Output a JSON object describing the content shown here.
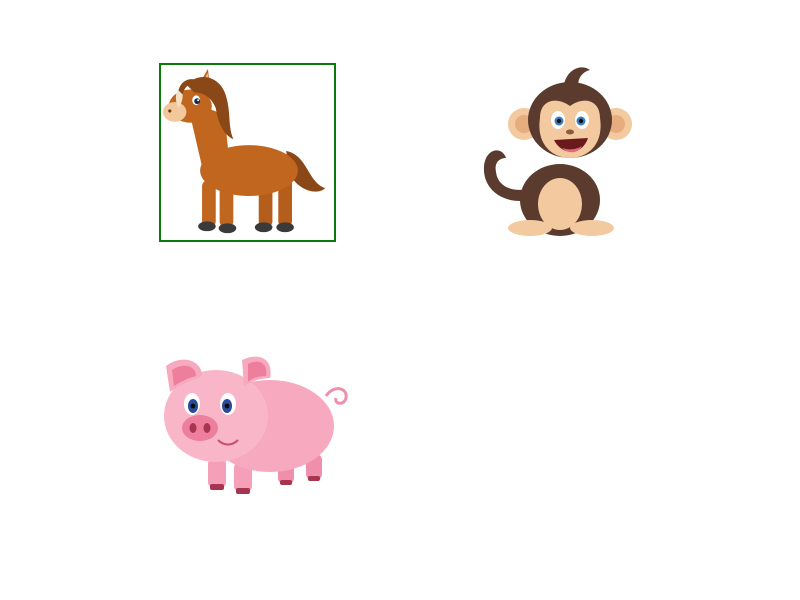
{
  "game": {
    "cards": [
      {
        "animal": "horse",
        "selected": true,
        "icon": "horse-icon"
      },
      {
        "animal": "monkey",
        "selected": false,
        "icon": "monkey-icon"
      },
      {
        "animal": "pig",
        "selected": false,
        "icon": "pig-icon"
      }
    ],
    "colors": {
      "background": "#ffffff",
      "selection_border": "#0a7a0a",
      "horse_body": "#c0661f",
      "horse_mane": "#8a4718",
      "monkey_fur": "#5a3b2e",
      "monkey_face": "#f3c9a0",
      "pig_body": "#f7a9bf",
      "pig_snout": "#ee7f9c"
    }
  }
}
